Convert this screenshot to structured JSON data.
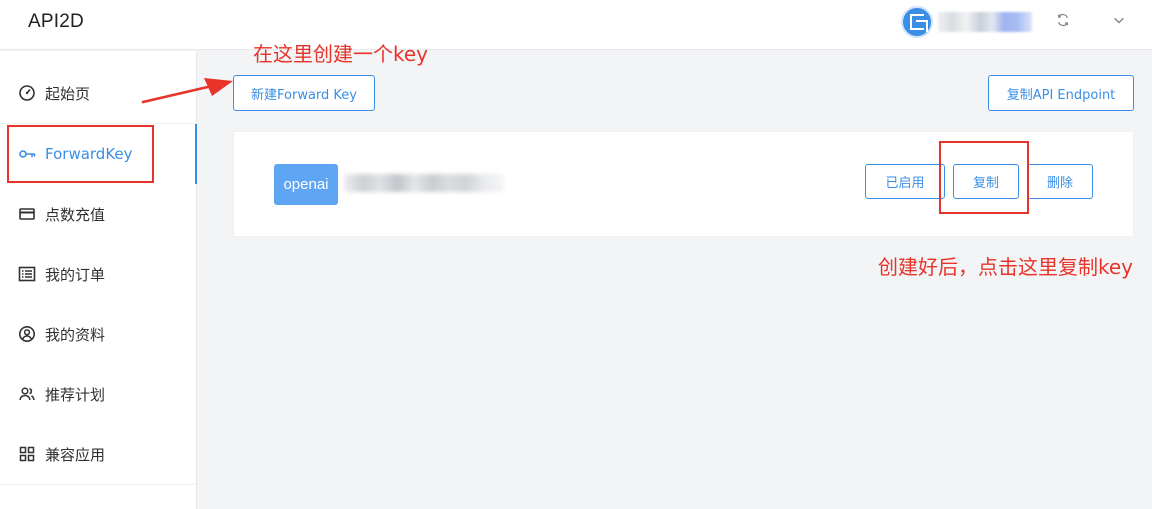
{
  "header": {
    "logo": "API2D",
    "icons": {
      "avatar": "avatar-icon",
      "refresh": "refresh-icon",
      "menu": "chevron-down-icon"
    }
  },
  "sidebar": {
    "items": [
      {
        "label": "起始页",
        "icon": "dashboard-icon"
      },
      {
        "label": "ForwardKey",
        "icon": "key-icon",
        "active": true
      },
      {
        "label": "点数充值",
        "icon": "credit-card-icon"
      },
      {
        "label": "我的订单",
        "icon": "list-icon"
      },
      {
        "label": "我的资料",
        "icon": "user-circle-icon"
      },
      {
        "label": "推荐计划",
        "icon": "users-icon"
      },
      {
        "label": "兼容应用",
        "icon": "grid-icon"
      }
    ]
  },
  "toolbar": {
    "new_key_label": "新建Forward Key",
    "copy_endpoint_label": "复制API Endpoint"
  },
  "key_card": {
    "tag": "openai",
    "enabled_label": "已启用",
    "copy_label": "复制",
    "delete_label": "删除"
  },
  "annotations": {
    "top": "在这里创建一个key",
    "bottom": "创建好后，点击这里复制key"
  },
  "colors": {
    "accent": "#3a8ee6",
    "annotation": "#e8332a",
    "tag_bg": "#5ea6f4"
  }
}
